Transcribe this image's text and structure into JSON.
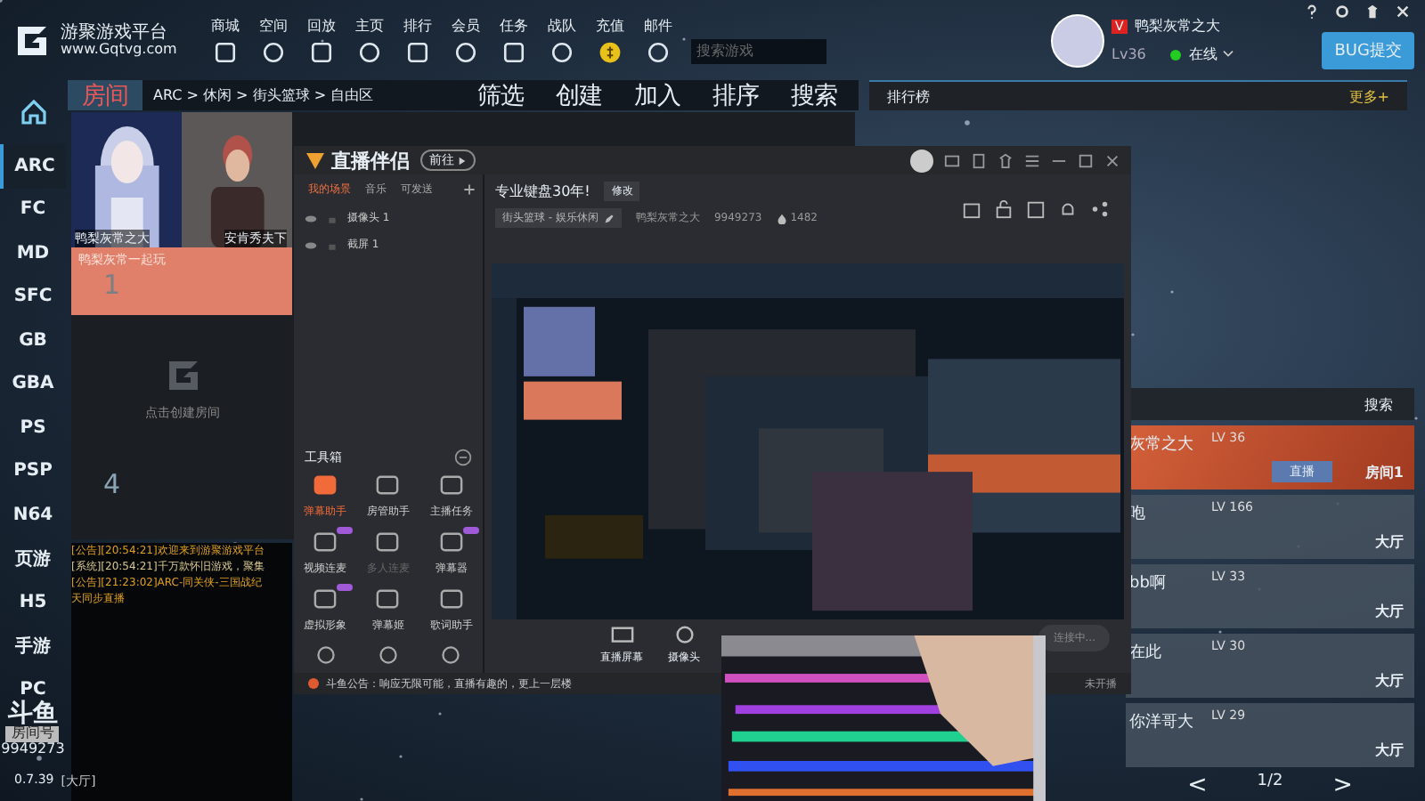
{
  "header": {
    "title": "游聚游戏平台",
    "url": "www.Gqtvg.com",
    "nav": [
      {
        "label": "商城"
      },
      {
        "label": "空间"
      },
      {
        "label": "回放"
      },
      {
        "label": "主页"
      },
      {
        "label": "排行"
      },
      {
        "label": "会员"
      },
      {
        "label": "任务"
      },
      {
        "label": "战队"
      },
      {
        "label": "充值"
      },
      {
        "label": "邮件"
      }
    ],
    "search": {
      "placeholder": "搜索游戏"
    }
  },
  "user": {
    "vip": "V",
    "name": "鸭梨灰常之大",
    "level": "Lv36",
    "status": "在线",
    "bug_button": "BUG提交"
  },
  "sidebar": {
    "items": [
      {
        "label": "ARC",
        "selected": true
      },
      {
        "label": "FC",
        "selected": false
      },
      {
        "label": "MD",
        "selected": false
      },
      {
        "label": "SFC",
        "selected": false
      },
      {
        "label": "GB",
        "selected": false
      },
      {
        "label": "GBA",
        "selected": false
      },
      {
        "label": "PS",
        "selected": false
      },
      {
        "label": "PSP",
        "selected": false
      },
      {
        "label": "N64",
        "selected": false
      },
      {
        "label": "页游",
        "selected": false
      },
      {
        "label": "H5",
        "selected": false
      },
      {
        "label": "手游",
        "selected": false
      },
      {
        "label": "PC",
        "selected": false
      }
    ],
    "douyu_logo": "斗鱼",
    "room_label": "房间号",
    "room_id": "9949273",
    "version": "0.7.39",
    "location": "[大厅]"
  },
  "breadcrumb": {
    "tab": "房间",
    "path": "ARC > 休闲 > 街头篮球 > 自由区",
    "actions": [
      "筛选",
      "创建",
      "加入",
      "排序",
      "搜索"
    ]
  },
  "rooms": [
    {
      "kind": "occupied",
      "host": "鸭梨灰常之大",
      "guest": "安肯秀夫下",
      "title": "鸭梨灰常一起玩",
      "number": "1"
    },
    {
      "kind": "empty",
      "hint": "点击创建房间",
      "number": "4"
    }
  ],
  "chat": [
    {
      "kind": "notice",
      "text": "[公告][20:54:21]欢迎来到游聚游戏平台"
    },
    {
      "kind": "system",
      "text": "[系统][20:54:21]千万款怀旧游戏，聚集"
    },
    {
      "kind": "notice",
      "text": "[公告][21:23:02]ARC-同关侠-三国战纪"
    },
    {
      "kind": "notice",
      "text": "天同步直播"
    }
  ],
  "ranking": {
    "title": "排行榜",
    "more": "更多+"
  },
  "players": {
    "search": "搜索",
    "rows": [
      {
        "name": "灰常之大",
        "level": "LV 36",
        "live": "直播",
        "place": "房间1",
        "selected": true
      },
      {
        "name": "咆",
        "level": "LV 166",
        "place": "大厅",
        "selected": false
      },
      {
        "name": "bb啊",
        "level": "LV 33",
        "place": "大厅",
        "selected": false
      },
      {
        "name": "在此",
        "level": "LV 30",
        "place": "大厅",
        "selected": false
      },
      {
        "name": "你洋哥大",
        "level": "LV 29",
        "place": "大厅",
        "selected": false
      }
    ],
    "prev": "<",
    "page": "1/2",
    "next": ">"
  },
  "streamer": {
    "title": "直播伴侣",
    "pill": "前往",
    "scene_tabs": [
      {
        "label": "我的场景",
        "selected": true
      },
      {
        "label": "音乐",
        "selected": false
      },
      {
        "label": "可发送",
        "selected": false
      }
    ],
    "sources": [
      {
        "label": "摄像头 1"
      },
      {
        "label": "截屏 1"
      }
    ],
    "toolbox": "工具箱",
    "tools": [
      {
        "label": "弹幕助手",
        "active": true,
        "disabled": false,
        "badge": false
      },
      {
        "label": "房管助手",
        "active": false,
        "disabled": false,
        "badge": false
      },
      {
        "label": "主播任务",
        "active": false,
        "disabled": false,
        "badge": false
      },
      {
        "label": "视频连麦",
        "active": false,
        "disabled": false,
        "badge": true
      },
      {
        "label": "多人连麦",
        "active": false,
        "disabled": true,
        "badge": false
      },
      {
        "label": "弹幕器",
        "active": false,
        "disabled": false,
        "badge": true
      },
      {
        "label": "虚拟形象",
        "active": false,
        "disabled": false,
        "badge": true
      },
      {
        "label": "弹幕姬",
        "active": false,
        "disabled": false,
        "badge": false
      },
      {
        "label": "歌词助手",
        "active": false,
        "disabled": false,
        "badge": false
      }
    ],
    "room_title": "专业键盘30年!",
    "edit": "修改",
    "category": "街头篮球 - 娱乐休闲",
    "anchor": "鸭梨灰常之大",
    "room_id": "9949273",
    "viewers": "1482",
    "bottom_tools": [
      "直播屏幕",
      "摄像头"
    ],
    "connect": "连接中...",
    "notice": "斗鱼公告：响应无限可能，直播有趣的，更上一层楼",
    "status": "未开播"
  }
}
